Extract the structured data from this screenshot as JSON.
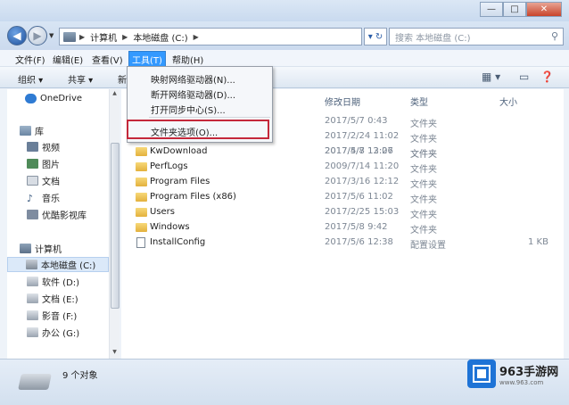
{
  "window": {
    "min": "—",
    "max": "□",
    "close": "✕"
  },
  "address": {
    "crumbs": [
      "计算机",
      "本地磁盘 (C:)"
    ],
    "search_placeholder": "搜索 本地磁盘 (C:)"
  },
  "menu": {
    "file": "文件(F)",
    "edit": "编辑(E)",
    "view": "查看(V)",
    "tools": "工具(T)",
    "help": "帮助(H)"
  },
  "toolbar": {
    "organize": "组织 ▾",
    "share": "共享 ▾",
    "new_partial": "新"
  },
  "tools_menu": {
    "map": "映射网络驱动器(N)...",
    "disconnect": "断开网络驱动器(D)...",
    "sync": "打开同步中心(S)...",
    "folder_options": "文件夹选项(O)..."
  },
  "columns": {
    "date": "修改日期",
    "type": "类型",
    "size": "大小"
  },
  "sidebar": {
    "onedrive": "OneDrive",
    "library": "库",
    "video": "视频",
    "pictures": "图片",
    "documents": "文档",
    "music": "音乐",
    "youku": "优酷影视库",
    "computer": "计算机",
    "c_drive": "本地磁盘 (C:)",
    "d_drive": "软件 (D:)",
    "e_drive": "文档 (E:)",
    "f_drive": "影音 (F:)",
    "g_drive": "办公 (G:)"
  },
  "files": [
    {
      "name": "",
      "date": "2017/5/7 0:43",
      "type": "文件夹",
      "size": ""
    },
    {
      "name": "",
      "date": "2017/2/24 11:02",
      "type": "文件夹",
      "size": ""
    },
    {
      "name": "",
      "date": "2017/4/8 13:07",
      "type": "文件夹",
      "size": ""
    },
    {
      "name": "KwDownload",
      "date": "2017/5/7 12:26",
      "type": "文件夹",
      "size": ""
    },
    {
      "name": "PerfLogs",
      "date": "2009/7/14 11:20",
      "type": "文件夹",
      "size": ""
    },
    {
      "name": "Program Files",
      "date": "2017/3/16 12:12",
      "type": "文件夹",
      "size": ""
    },
    {
      "name": "Program Files (x86)",
      "date": "2017/5/6 11:02",
      "type": "文件夹",
      "size": ""
    },
    {
      "name": "Users",
      "date": "2017/2/25 15:03",
      "type": "文件夹",
      "size": ""
    },
    {
      "name": "Windows",
      "date": "2017/5/8 9:42",
      "type": "文件夹",
      "size": ""
    },
    {
      "name": "InstallConfig",
      "date": "2017/5/6 12:38",
      "type": "配置设置",
      "size": "1 KB"
    }
  ],
  "status": {
    "count": "9 个对象"
  },
  "watermark": {
    "brand": "963手游网",
    "url": "www.963.com"
  },
  "colors": {
    "accent": "#3399ff",
    "highlight": "#c4283a"
  }
}
